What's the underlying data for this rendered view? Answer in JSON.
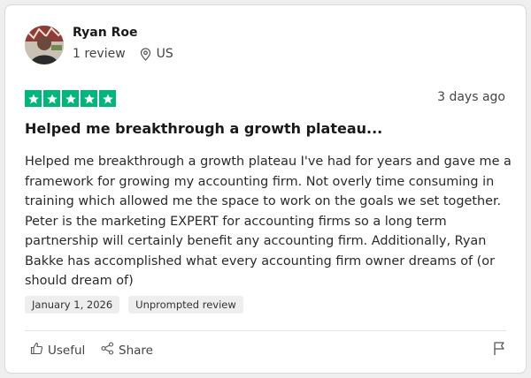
{
  "reviewer": {
    "name": "Ryan Roe",
    "review_count": "1 review",
    "country": "US"
  },
  "review": {
    "rating": 5,
    "rating_color": "#00b67a",
    "date_relative": "3 days ago",
    "title": "Helped me breakthrough a growth plateau...",
    "body": "Helped me breakthrough a growth plateau I've had for years and gave me a framework for growing my accounting firm. Not overly time consuming in training which allowed me the space to work on the goals we set together. Peter is the marketing EXPERT for accounting firms so a long term partnership will certainly benefit any accounting firm. Additionally, Ryan Bakke has accomplished what every accounting firm owner dreams of (or should dream of)",
    "tags": [
      "January 1, 2026",
      "Unprompted review"
    ]
  },
  "actions": {
    "useful_label": "Useful",
    "share_label": "Share"
  },
  "icons": {
    "location": "map-pin-icon",
    "useful": "thumbs-up-icon",
    "share": "share-icon",
    "report": "flag-icon"
  }
}
